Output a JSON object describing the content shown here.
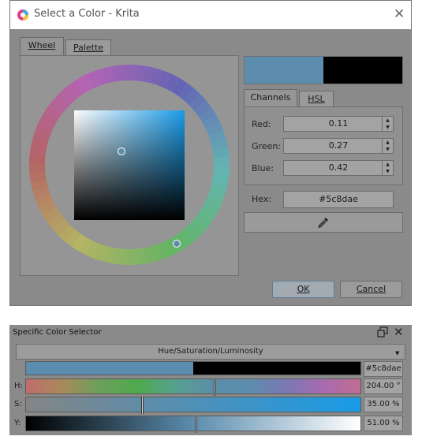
{
  "dialog": {
    "title": "Select a Color - Krita",
    "close_glyph": "✕",
    "tabs": [
      "Wheel",
      "Palette"
    ],
    "channel_tabs": [
      "Channels",
      "HSL"
    ],
    "channels": [
      {
        "label": "Red:",
        "value": "0.11"
      },
      {
        "label": "Green:",
        "value": "0.27"
      },
      {
        "label": "Blue:",
        "value": "0.42"
      }
    ],
    "hex_label": "Hex:",
    "hex_value": "#5c8dae",
    "ok_label": "OK",
    "cancel_label": "Cancel",
    "current_color": "#5c8dae",
    "previous_color": "#000000",
    "icons": [
      "krita-logo-icon",
      "close-icon",
      "eyedropper-icon",
      "spin-up-icon",
      "spin-down-icon"
    ]
  },
  "docker": {
    "title": "Specific Color Selector",
    "mode": "Hue/Saturation/Luminosity",
    "hex_value": "#5c8dae",
    "rows": [
      {
        "label": "H:",
        "value": "204.00 °",
        "level": 0.5667
      },
      {
        "label": "S:",
        "value": "35.00 %",
        "level": 0.35
      },
      {
        "label": "Y:",
        "value": "51.00 %",
        "level": 0.51
      }
    ],
    "current_color": "#5c8dae",
    "previous_color": "#000000",
    "icons": [
      "float-icon",
      "close-icon",
      "chevron-down-icon"
    ]
  }
}
